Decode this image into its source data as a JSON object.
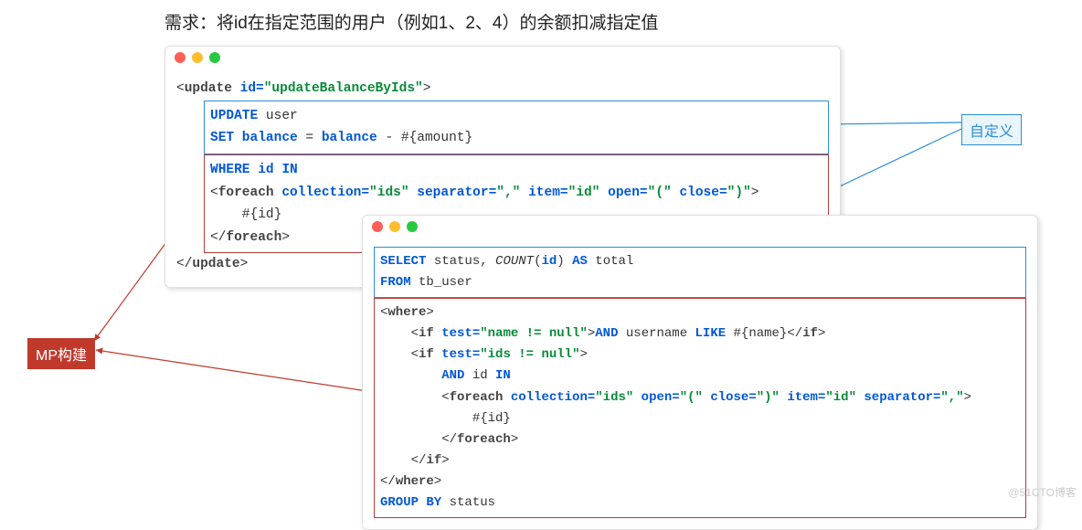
{
  "title": "需求：将id在指定范围的用户（例如1、2、4）的余额扣减指定值",
  "callouts": {
    "custom": "自定义",
    "mp": "MP构建"
  },
  "watermark": "@51CTO博客",
  "code1": {
    "l1_open": "<update ",
    "l1_attr": "id=",
    "l1_val": "\"updateBalanceByIds\"",
    "l1_close": ">",
    "b1_l1_kw1": "UPDATE",
    "b1_l1_txt": " user",
    "b1_l2_kw1": "SET",
    "b1_l2_kw2": " balance",
    "b1_l2_eq": " = ",
    "b1_l2_kw3": "balance",
    "b1_l2_txt": " - #{amount}",
    "r1_l1_kw1": "WHERE",
    "r1_l1_kw2": " id IN",
    "r1_l2_open": "<foreach ",
    "r1_l2_a1": "collection=",
    "r1_l2_v1": "\"ids\"",
    "r1_l2_a2": " separator=",
    "r1_l2_v2": "\",\"",
    "r1_l2_a3": " item=",
    "r1_l2_v3": "\"id\"",
    "r1_l2_a4": " open=",
    "r1_l2_v4": "\"(\"",
    "r1_l2_a5": " close=",
    "r1_l2_v5": "\")\"",
    "r1_l2_close": ">",
    "r1_l3": "    #{id}",
    "r1_l4": "</foreach>",
    "lz": "</update>"
  },
  "code2": {
    "b_l1a": "SELECT",
    "b_l1b": " status, ",
    "b_l1c": "COUNT",
    "b_l1d": "(",
    "b_l1e": "id",
    "b_l1f": ") ",
    "b_l1g": "AS",
    "b_l1h": " total",
    "b_l2a": "FROM",
    "b_l2b": " tb_user",
    "r_l1": "<where>",
    "r_l2_open": "    <if ",
    "r_l2_attr": "test=",
    "r_l2_val": "\"name != null\"",
    "r_l2_close": ">",
    "r_l2_kw1": "AND",
    "r_l2_txt1": " username ",
    "r_l2_kw2": "LIKE",
    "r_l2_txt2": " #{name}",
    "r_l2_end": "</if>",
    "r_l3_open": "    <if ",
    "r_l3_attr": "test=",
    "r_l3_val": "\"ids != null\"",
    "r_l3_close": ">",
    "r_l4_kw1": "        AND",
    "r_l4_txt1": " id ",
    "r_l4_kw2": "IN",
    "r_l5_open": "        <foreach ",
    "r_l5_a1": "collection=",
    "r_l5_v1": "\"ids\"",
    "r_l5_a2": " open=",
    "r_l5_v2": "\"(\"",
    "r_l5_a3": " close=",
    "r_l5_v3": "\")\"",
    "r_l5_a4": " item=",
    "r_l5_v4": "\"id\"",
    "r_l5_a5": " separator=",
    "r_l5_v5": "\",\"",
    "r_l5_close": ">",
    "r_l6": "            #{id}",
    "r_l7": "        </foreach>",
    "r_l8": "    </if>",
    "r_l9": "</where>",
    "r_l10a": "GROUP BY",
    "r_l10b": " status"
  }
}
